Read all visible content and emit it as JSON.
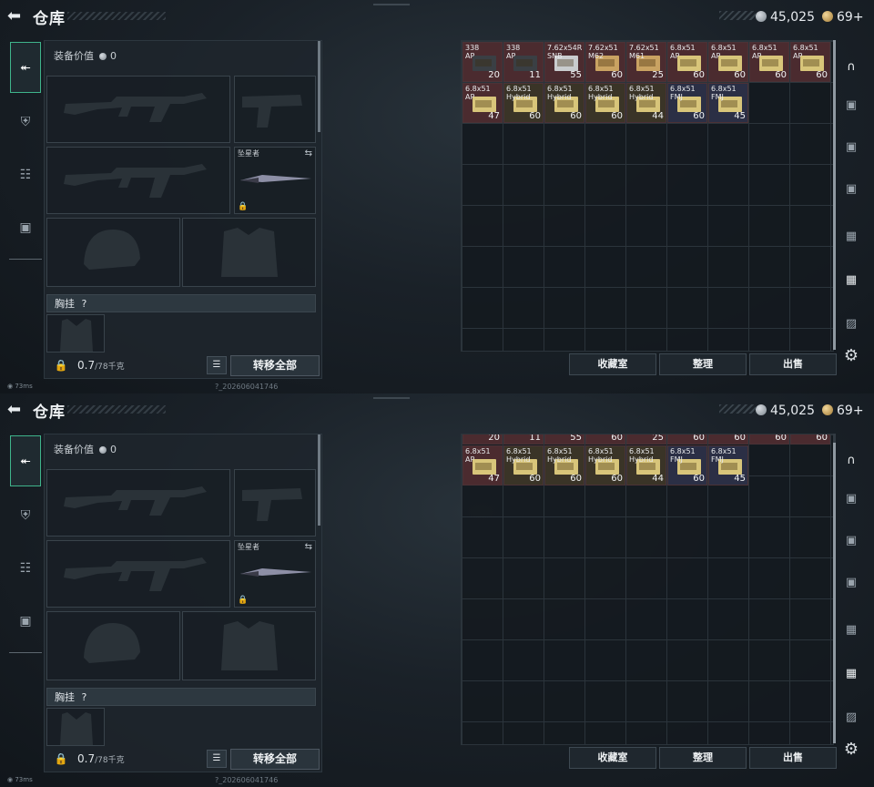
{
  "screens": [
    {
      "header": {
        "title": "仓库",
        "silver": "45,025",
        "gold": "69+"
      },
      "equipment": {
        "value_label": "装备价值",
        "value": "0",
        "melee_name": "坠星者",
        "rig_label": "胸挂",
        "rig_help": "?",
        "weight_value": "0.7",
        "weight_max": "/78千克",
        "transfer_label": "转移全部"
      },
      "stash": {
        "scroll_fraction_start": 0.0,
        "items": [
          {
            "cal": "338",
            "type": "AP",
            "qty": "20",
            "kind": "dark",
            "color": "#4b2b2f",
            "row": 0
          },
          {
            "cal": "338",
            "type": "AP",
            "qty": "11",
            "kind": "dark",
            "color": "#4b2b2f",
            "row": 0
          },
          {
            "cal": "7.62x54R",
            "type": "SNB",
            "qty": "55",
            "kind": "white",
            "color": "#4b2b2f",
            "row": 0
          },
          {
            "cal": "7.62x51",
            "type": "M62",
            "qty": "60",
            "kind": "tan",
            "color": "#4b2b2f",
            "row": 0
          },
          {
            "cal": "7.62x51",
            "type": "M61",
            "qty": "25",
            "kind": "tan",
            "color": "#4b2b2f",
            "row": 0
          },
          {
            "cal": "6.8x51",
            "type": "AP",
            "qty": "60",
            "kind": "yellow",
            "color": "#4b2b2f",
            "row": 0
          },
          {
            "cal": "6.8x51",
            "type": "AP",
            "qty": "60",
            "kind": "yellow",
            "color": "#4b2b2f",
            "row": 0
          },
          {
            "cal": "6.8x51",
            "type": "AP",
            "qty": "60",
            "kind": "yellow",
            "color": "#4b2b2f",
            "row": 0
          },
          {
            "cal": "6.8x51",
            "type": "AP",
            "qty": "60",
            "kind": "yellow",
            "color": "#4b2b2f",
            "row": 0
          },
          {
            "cal": "6.8x51",
            "type": "AP",
            "qty": "47",
            "kind": "yellow",
            "color": "#4b2b2f",
            "row": 1
          },
          {
            "cal": "6.8x51",
            "type": "Hybrid",
            "qty": "60",
            "kind": "yellow",
            "color": "#3a3427",
            "row": 1
          },
          {
            "cal": "6.8x51",
            "type": "Hybrid",
            "qty": "60",
            "kind": "yellow",
            "color": "#3a3427",
            "row": 1
          },
          {
            "cal": "6.8x51",
            "type": "Hybrid",
            "qty": "60",
            "kind": "yellow",
            "color": "#3a3427",
            "row": 1
          },
          {
            "cal": "6.8x51",
            "type": "Hybrid",
            "qty": "44",
            "kind": "yellow",
            "color": "#3a3427",
            "row": 1
          },
          {
            "cal": "6.8x51",
            "type": "FMJ",
            "qty": "60",
            "kind": "yellow",
            "color": "#2b2f45",
            "row": 1
          },
          {
            "cal": "6.8x51",
            "type": "FMJ",
            "qty": "45",
            "kind": "yellow",
            "color": "#2b2f45",
            "row": 1
          }
        ]
      },
      "buttons": {
        "collection": "收藏室",
        "sort": "整理",
        "sell": "出售"
      },
      "status": {
        "ping": "73ms",
        "build": "?_202606041746"
      }
    },
    {
      "header": {
        "title": "仓库",
        "silver": "45,025",
        "gold": "69+"
      },
      "equipment": {
        "value_label": "装备价值",
        "value": "0",
        "melee_name": "坠星者",
        "rig_label": "胸挂",
        "rig_help": "?",
        "weight_value": "0.7",
        "weight_max": "/78千克",
        "transfer_label": "转移全部"
      },
      "stash": {
        "scroll_fraction_start": 0.1,
        "items": [
          {
            "cal": "",
            "type": "",
            "qty": "20",
            "kind": "dark",
            "color": "#4b2b2f",
            "row": 0
          },
          {
            "cal": "",
            "type": "",
            "qty": "11",
            "kind": "dark",
            "color": "#4b2b2f",
            "row": 0
          },
          {
            "cal": "",
            "type": "",
            "qty": "55",
            "kind": "white",
            "color": "#4b2b2f",
            "row": 0
          },
          {
            "cal": "",
            "type": "",
            "qty": "60",
            "kind": "tan",
            "color": "#4b2b2f",
            "row": 0
          },
          {
            "cal": "",
            "type": "",
            "qty": "25",
            "kind": "tan",
            "color": "#4b2b2f",
            "row": 0
          },
          {
            "cal": "",
            "type": "",
            "qty": "60",
            "kind": "yellow",
            "color": "#4b2b2f",
            "row": 0
          },
          {
            "cal": "",
            "type": "",
            "qty": "60",
            "kind": "yellow",
            "color": "#4b2b2f",
            "row": 0
          },
          {
            "cal": "",
            "type": "",
            "qty": "60",
            "kind": "yellow",
            "color": "#4b2b2f",
            "row": 0
          },
          {
            "cal": "",
            "type": "",
            "qty": "60",
            "kind": "yellow",
            "color": "#4b2b2f",
            "row": 0
          },
          {
            "cal": "6.8x51",
            "type": "AP",
            "qty": "47",
            "kind": "yellow",
            "color": "#4b2b2f",
            "row": 1
          },
          {
            "cal": "6.8x51",
            "type": "Hybrid",
            "qty": "60",
            "kind": "yellow",
            "color": "#3a3427",
            "row": 1
          },
          {
            "cal": "6.8x51",
            "type": "Hybrid",
            "qty": "60",
            "kind": "yellow",
            "color": "#3a3427",
            "row": 1
          },
          {
            "cal": "6.8x51",
            "type": "Hybrid",
            "qty": "60",
            "kind": "yellow",
            "color": "#3a3427",
            "row": 1
          },
          {
            "cal": "6.8x51",
            "type": "Hybrid",
            "qty": "44",
            "kind": "yellow",
            "color": "#3a3427",
            "row": 1
          },
          {
            "cal": "6.8x51",
            "type": "FMJ",
            "qty": "60",
            "kind": "yellow",
            "color": "#2b2f45",
            "row": 1
          },
          {
            "cal": "6.8x51",
            "type": "FMJ",
            "qty": "45",
            "kind": "yellow",
            "color": "#2b2f45",
            "row": 1
          }
        ]
      },
      "buttons": {
        "collection": "收藏室",
        "sort": "整理",
        "sell": "出售"
      },
      "status": {
        "ping": "73ms",
        "build": "?_202606041746"
      }
    }
  ]
}
